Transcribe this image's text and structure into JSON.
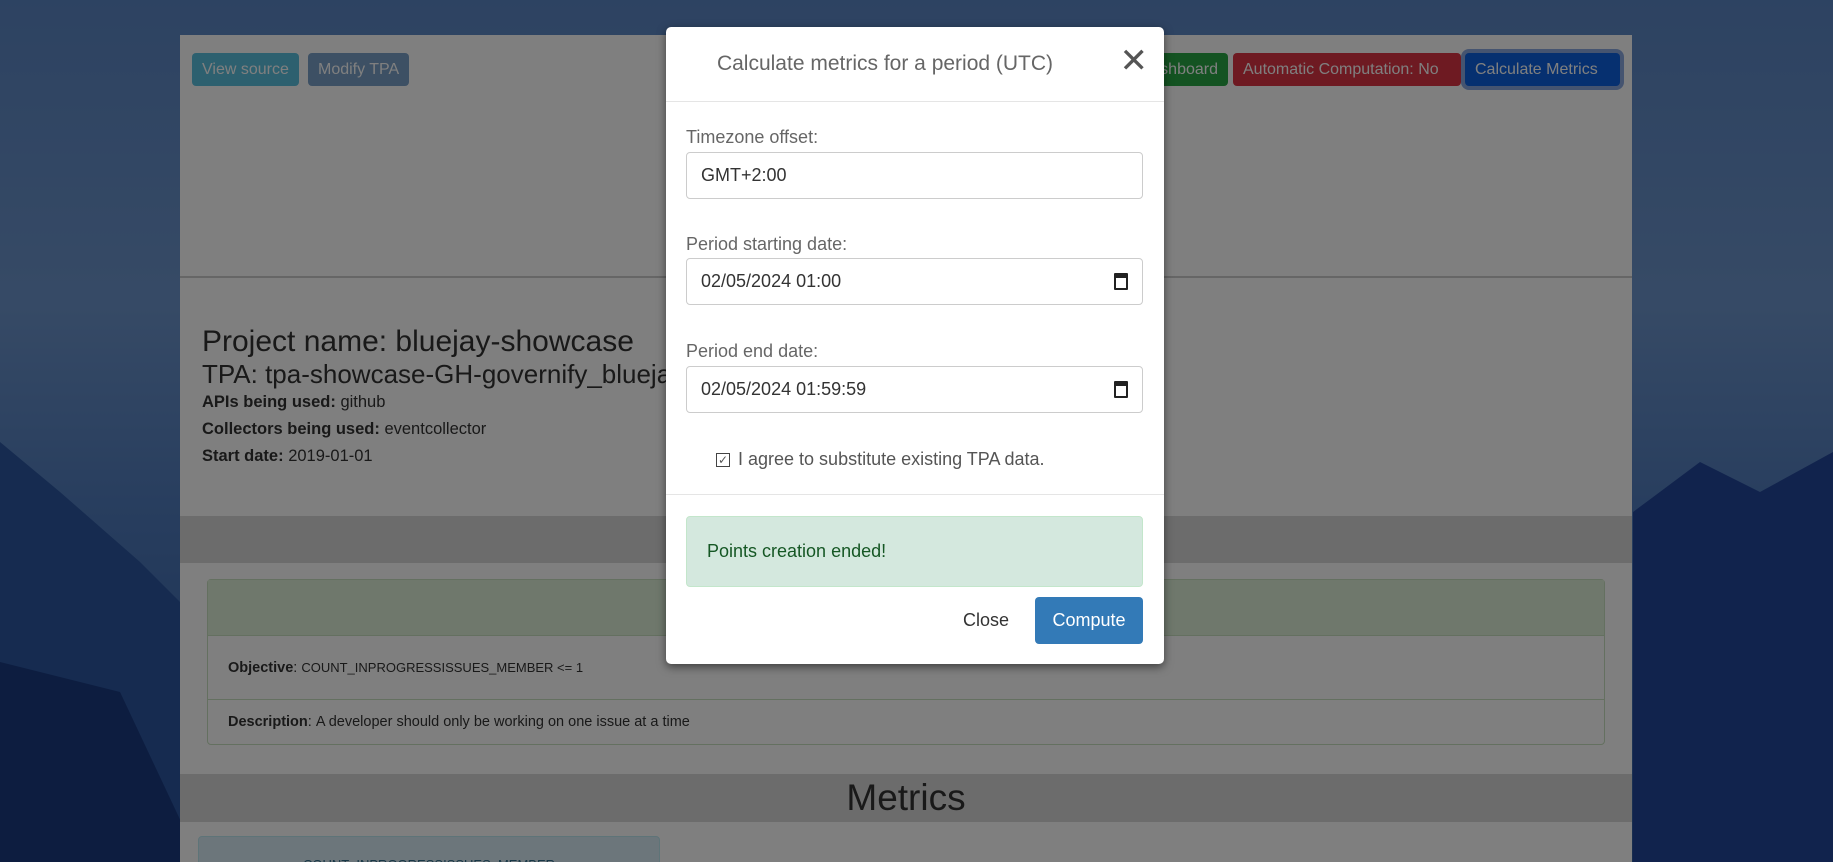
{
  "toolbar": {
    "view_source": "View source",
    "modify_tpa": "Modify TPA",
    "dashboard": "Dashboard",
    "automatic_computation": "Automatic Computation: No",
    "calculate_metrics": "Calculate Metrics"
  },
  "project": {
    "name": "Project name: bluejay-showcase",
    "tpa": "TPA: tpa-showcase-GH-governify_bluejay-showcase",
    "apis_label": "APIs being used:",
    "apis_value": "github",
    "collectors_label": "Collectors being used:",
    "collectors_value": "eventcollector",
    "start_label": "Start date:",
    "start_value": "2019-01-01"
  },
  "guarantee": {
    "objective_label": "Objective",
    "objective_value": "COUNT_INPROGRESSISSUES_MEMBER <= 1",
    "description_label": "Description",
    "description_value": "A developer should only be working on one issue at a time"
  },
  "metrics": {
    "title": "Metrics",
    "card_title": "COUNT_INPROGRESSISSUES_MEMBER"
  },
  "modal": {
    "title": "Calculate metrics for a period (UTC)",
    "timezone_label": "Timezone offset:",
    "timezone_value": "GMT+2:00",
    "start_label": "Period starting date:",
    "start_value": "02/05/2024 01:00",
    "end_label": "Period end date:",
    "end_value": "02/05/2024 01:59:59",
    "agree_label": "I agree to substitute existing TPA data.",
    "agree_checked": true,
    "alert": "Points creation ended!",
    "close": "Close",
    "compute": "Compute"
  },
  "colors": {
    "info": "#5bc0de",
    "danger": "#dc3545",
    "primary": "#0d60e0",
    "success": "#28a745",
    "compute": "#337ab7"
  }
}
